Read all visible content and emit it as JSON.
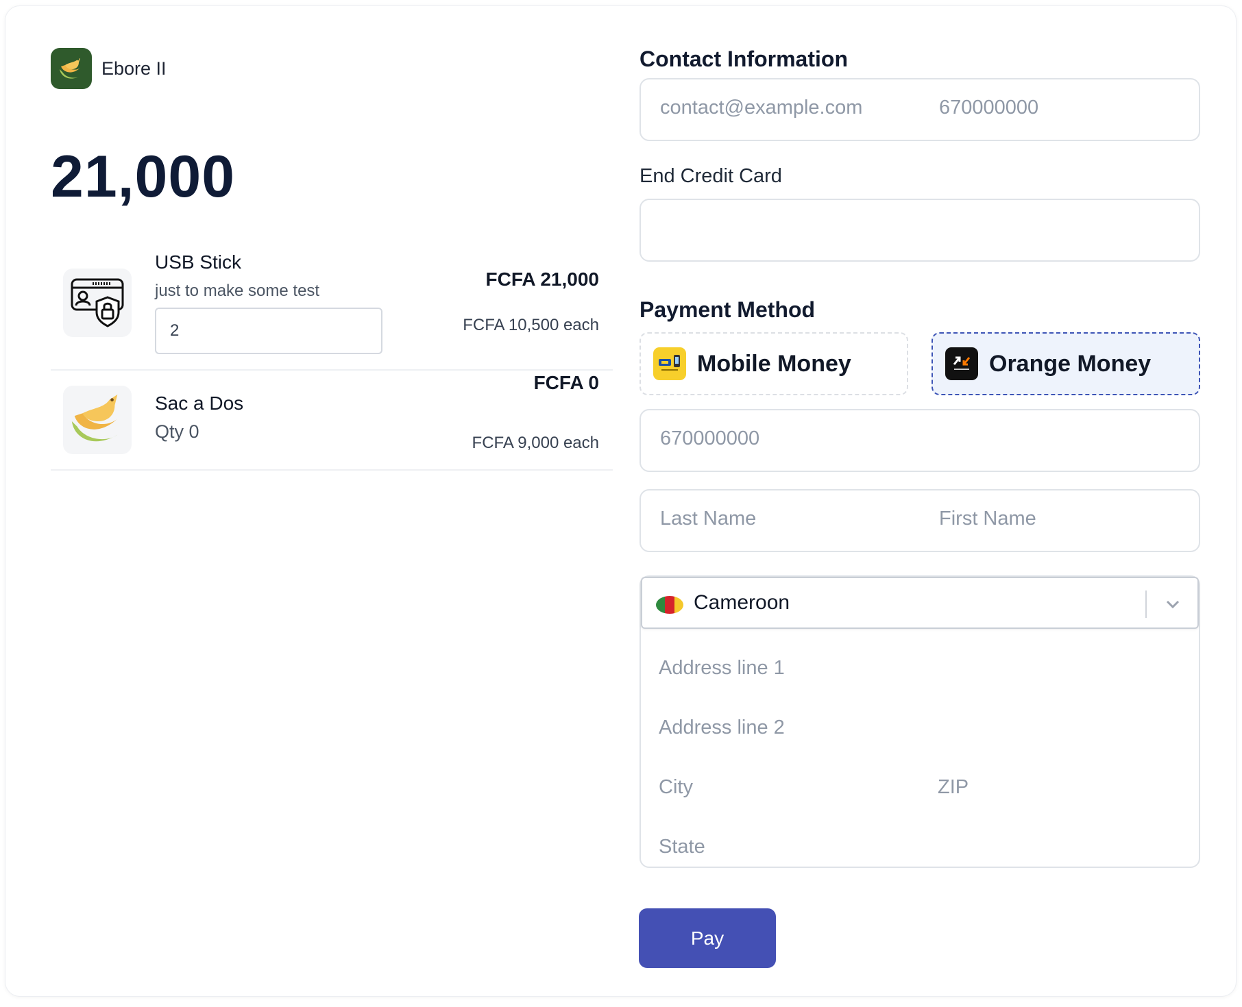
{
  "brand": {
    "name": "Ebore II",
    "logo_icon": "bird-logo-icon"
  },
  "order": {
    "total": "21,000",
    "items": [
      {
        "name": "USB Stick",
        "description": "just to make some test",
        "quantity": "2",
        "price": "FCFA 21,000",
        "unit_price": "FCFA 10,500 each",
        "icon": "usb-lock-icon"
      },
      {
        "name": "Sac a Dos",
        "qty_text": "Qty 0",
        "price": "FCFA 0",
        "unit_price": "FCFA 9,000 each",
        "icon": "bird-logo-icon"
      }
    ]
  },
  "contact": {
    "heading": "Contact Information",
    "email_placeholder": "contact@example.com",
    "phone_placeholder": "670000000"
  },
  "card": {
    "label": "End Credit Card"
  },
  "payment": {
    "heading": "Payment Method",
    "options": [
      {
        "label": "Mobile Money",
        "icon": "mtn-mobile-money-icon",
        "selected": false
      },
      {
        "label": "Orange Money",
        "icon": "orange-money-icon",
        "selected": true
      }
    ],
    "phone_placeholder": "670000000",
    "last_name_placeholder": "Last Name",
    "first_name_placeholder": "First Name"
  },
  "address": {
    "country": "Cameroon",
    "line1_placeholder": "Address line 1",
    "line2_placeholder": "Address line 2",
    "city_placeholder": "City",
    "zip_placeholder": "ZIP",
    "state_placeholder": "State"
  },
  "actions": {
    "pay_label": "Pay"
  },
  "colors": {
    "accent": "#4450b4",
    "selected_border": "#3d54b6",
    "selected_bg": "#eef3fc",
    "brand_green": "#2f5a2c"
  }
}
